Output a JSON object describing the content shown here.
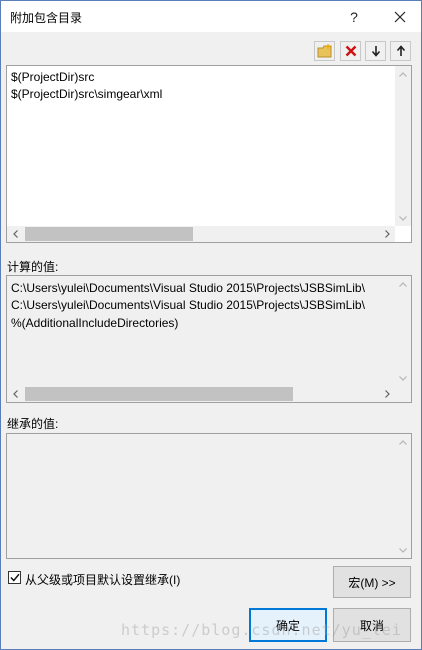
{
  "window": {
    "title": "附加包含目录",
    "help_label": "?"
  },
  "toolbar": {
    "buttons": [
      "new-folder-icon",
      "delete-icon",
      "move-down-icon",
      "move-up-icon"
    ]
  },
  "include_dirs": {
    "lines": [
      "$(ProjectDir)src",
      "$(ProjectDir)src\\simgear\\xml"
    ]
  },
  "computed": {
    "label": "计算的值:",
    "lines": [
      "C:\\Users\\yulei\\Documents\\Visual Studio 2015\\Projects\\JSBSimLib\\",
      "C:\\Users\\yulei\\Documents\\Visual Studio 2015\\Projects\\JSBSimLib\\",
      "%(AdditionalIncludeDirectories)"
    ]
  },
  "inherited": {
    "label": "继承的值:",
    "lines": []
  },
  "options": {
    "inherit_label": "从父级或项目默认设置继承(I)",
    "inherit_checked": true
  },
  "buttons": {
    "macros": "宏(M) >>",
    "ok": "确定",
    "cancel": "取消"
  },
  "watermark": "https://blog.csdn.net/yu_lei"
}
